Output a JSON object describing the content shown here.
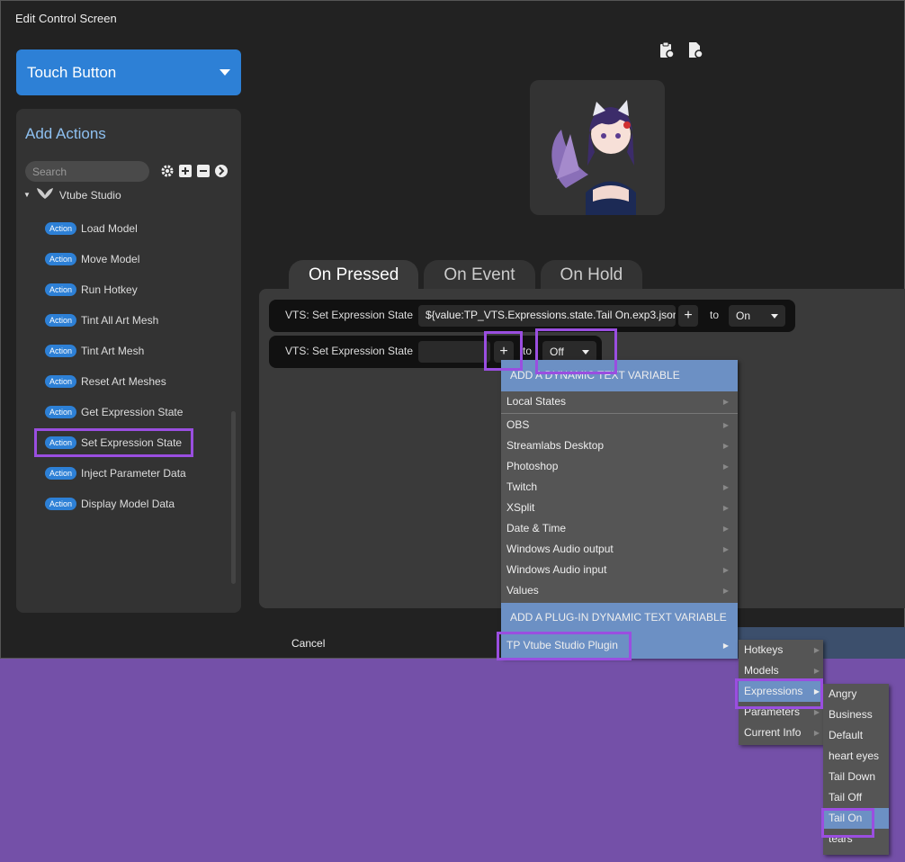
{
  "window": {
    "title": "Edit Control Screen"
  },
  "control_type": {
    "selected": "Touch Button"
  },
  "actions": {
    "title": "Add Actions",
    "search_placeholder": "Search",
    "group": "Vtube Studio",
    "badge": "Action",
    "items": [
      "Load Model",
      "Move Model",
      "Run Hotkey",
      "Tint All Art Mesh",
      "Tint Art Mesh",
      "Reset Art Meshes",
      "Get Expression State",
      "Set Expression State",
      "Inject Parameter Data",
      "Display Model Data"
    ]
  },
  "tabs": [
    "On Pressed",
    "On Event",
    "On Hold"
  ],
  "rows": [
    {
      "label": "VTS: Set Expression State",
      "value": "${value:TP_VTS.Expressions.state.Tail On.exp3.json}",
      "to": "to",
      "state": "On"
    },
    {
      "label": "VTS: Set Expression State",
      "value": "",
      "to": "to",
      "state": "Off"
    }
  ],
  "plus_label": "+",
  "cancel_label": "Cancel",
  "menu": {
    "header": "ADD A DYNAMIC TEXT VARIABLE",
    "local": "Local States",
    "items": [
      "OBS",
      "Streamlabs Desktop",
      "Photoshop",
      "Twitch",
      "XSplit",
      "Date & Time",
      "Windows Audio output",
      "Windows Audio input",
      "Values"
    ],
    "plugin_header": "ADD A PLUG-IN DYNAMIC TEXT VARIABLE",
    "plugin": "TP Vtube Studio Plugin"
  },
  "submenu": [
    "Hotkeys",
    "Models",
    "Expressions",
    "Parameters",
    "Current Info"
  ],
  "expressions": [
    "Angry",
    "Business",
    "Default",
    "heart eyes",
    "Tail Down",
    "Tail Off",
    "Tail On",
    "tears"
  ],
  "colors": {
    "accent": "#2d80d6",
    "highlight": "#9a4ee0",
    "menu_selected": "#6c90c4",
    "background": "#7450a8"
  }
}
